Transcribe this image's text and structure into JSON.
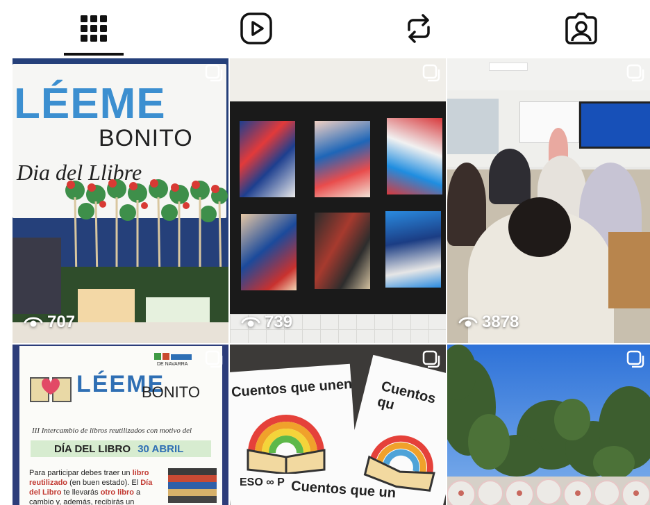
{
  "tabs": [
    {
      "id": "posts",
      "icon": "grid-icon",
      "selected": true
    },
    {
      "id": "reels",
      "icon": "reels-play-icon",
      "selected": false
    },
    {
      "id": "reposts",
      "icon": "repost-icon",
      "selected": false
    },
    {
      "id": "tagged",
      "icon": "tagged-person-icon",
      "selected": false
    }
  ],
  "posts": [
    {
      "views": "707",
      "multi": true,
      "text": {
        "leeme": "LÉEME",
        "bonito": "BONITO",
        "dia": "Dia del Llibre"
      }
    },
    {
      "views": "739",
      "multi": true
    },
    {
      "views": "3878",
      "multi": true
    },
    {
      "multi": true,
      "text": {
        "leeme": "LÉEME",
        "bonito": "BONITO",
        "logo": "DE NAVARRA",
        "subtitle": "III Intercambio de libros reutilizados con motivo del",
        "dia": "DÍA DEL LIBRO",
        "fecha": "30 ABRIL",
        "body1": "Para participar debes traer un ",
        "body1b": "libro reutilizado",
        "body2": " (en buen estado). El ",
        "body2b": "Día del Libro",
        "body3": " te llevarás ",
        "body3b": "otro libro",
        "body4": " a cambio y, además, recibirás un"
      }
    },
    {
      "multi": true,
      "text": {
        "c1": "Cuentos que unen",
        "c2": "Cuentos qu",
        "c3": "Cuentos que un",
        "eso": "ESO ∞ P"
      }
    },
    {
      "multi": true
    }
  ],
  "colors": {
    "tab_icon": "#111111",
    "underline": "#111111",
    "grid_gap": "#ffffff"
  }
}
